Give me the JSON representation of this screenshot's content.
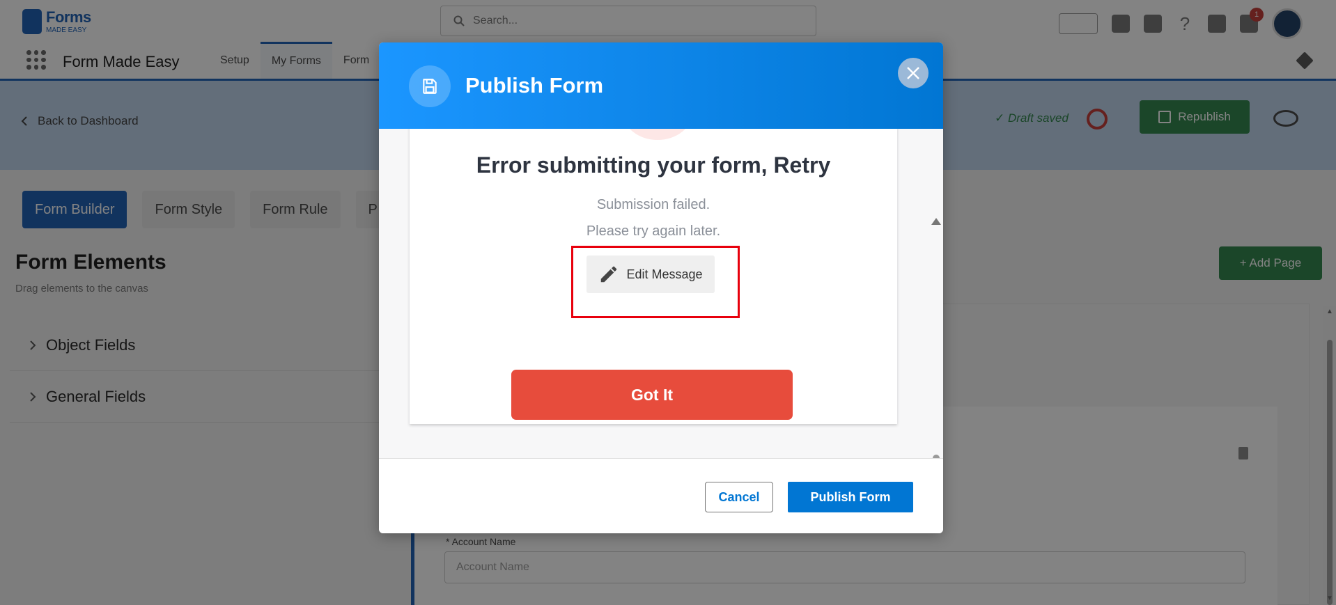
{
  "topbar": {
    "logo_text": "Forms",
    "logo_tagline": "MADE EASY",
    "search_placeholder": "Search...",
    "notification_count": "1"
  },
  "navbar": {
    "app_name": "Form Made Easy",
    "tabs": [
      {
        "label": "Setup"
      },
      {
        "label": "My Forms"
      },
      {
        "label": "Form"
      }
    ]
  },
  "hero": {
    "back_label": "Back to Dashboard",
    "draft_status": "✓ Draft saved",
    "republish_label": "Republish"
  },
  "builder": {
    "tabs": [
      {
        "label": "Form Builder"
      },
      {
        "label": "Form Style"
      },
      {
        "label": "Form Rule"
      },
      {
        "label": "P"
      }
    ],
    "elements_title": "Form Elements",
    "elements_subtitle": "Drag elements to the canvas",
    "accordions": [
      {
        "label": "Object Fields"
      },
      {
        "label": "General Fields"
      }
    ],
    "add_page_label": "+ Add Page",
    "field_label": "* Account Name",
    "field_placeholder": "Account Name"
  },
  "modal": {
    "title": "Publish Form",
    "close_label": "×",
    "error_title": "Error submitting your form, Retry",
    "error_message_1": "Submission failed.",
    "error_message_2": "Please try again later.",
    "edit_message_label": "Edit Message",
    "got_it_label": "Got It",
    "cancel_label": "Cancel",
    "publish_label": "Publish Form"
  },
  "colors": {
    "header_gradient_start": "#1b96ff",
    "header_gradient_end": "#0176d3",
    "got_it": "#e74c3c",
    "highlight": "#e8000d",
    "publish": "#0176d3"
  },
  "icons": [
    "search-icon",
    "save-icon",
    "close-icon",
    "pencil-icon",
    "chevron-right-icon",
    "chevron-left-icon"
  ]
}
